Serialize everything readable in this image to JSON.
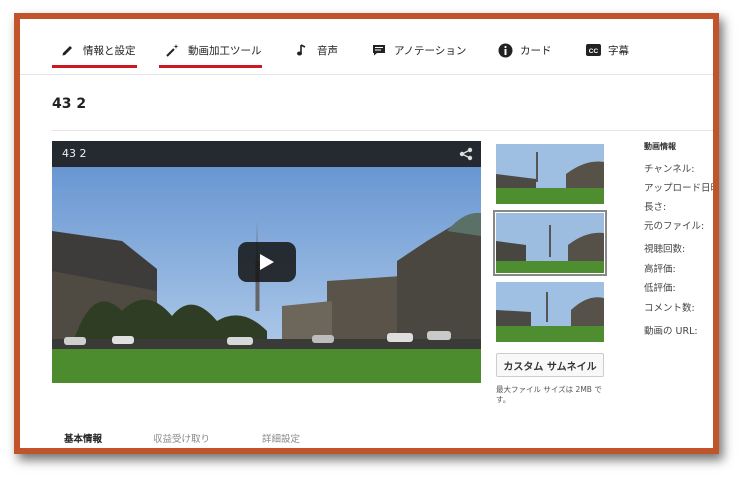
{
  "tabs": [
    {
      "label": "情報と設定",
      "icon": "pencil-icon"
    },
    {
      "label": "動画加工ツール",
      "icon": "magic-wand-icon"
    },
    {
      "label": "音声",
      "icon": "music-note-icon"
    },
    {
      "label": "アノテーション",
      "icon": "speech-bubble-icon"
    },
    {
      "label": "カード",
      "icon": "info-icon"
    },
    {
      "label": "字幕",
      "icon": "cc-icon"
    }
  ],
  "video": {
    "title": "43 2"
  },
  "player": {
    "title": "43 2",
    "share_icon": "share-icon",
    "play_icon": "play-icon"
  },
  "thumbnails": {
    "custom_label": "カスタム サムネイル",
    "max_size_text": "最大ファイル サイズは 2MB です。"
  },
  "info": {
    "header": "動画情報",
    "rows": [
      "チャンネル:",
      "アップロード日時",
      "長さ:",
      "元のファイル:",
      "視聴回数:",
      "高評価:",
      "低評価:",
      "コメント数:",
      "動画の URL:"
    ]
  },
  "bottom_tabs": [
    {
      "label": "基本情報"
    },
    {
      "label": "収益受け取り"
    },
    {
      "label": "詳細設定"
    }
  ],
  "colors": {
    "accent": "#cc181e",
    "frame": "#c1542a"
  }
}
